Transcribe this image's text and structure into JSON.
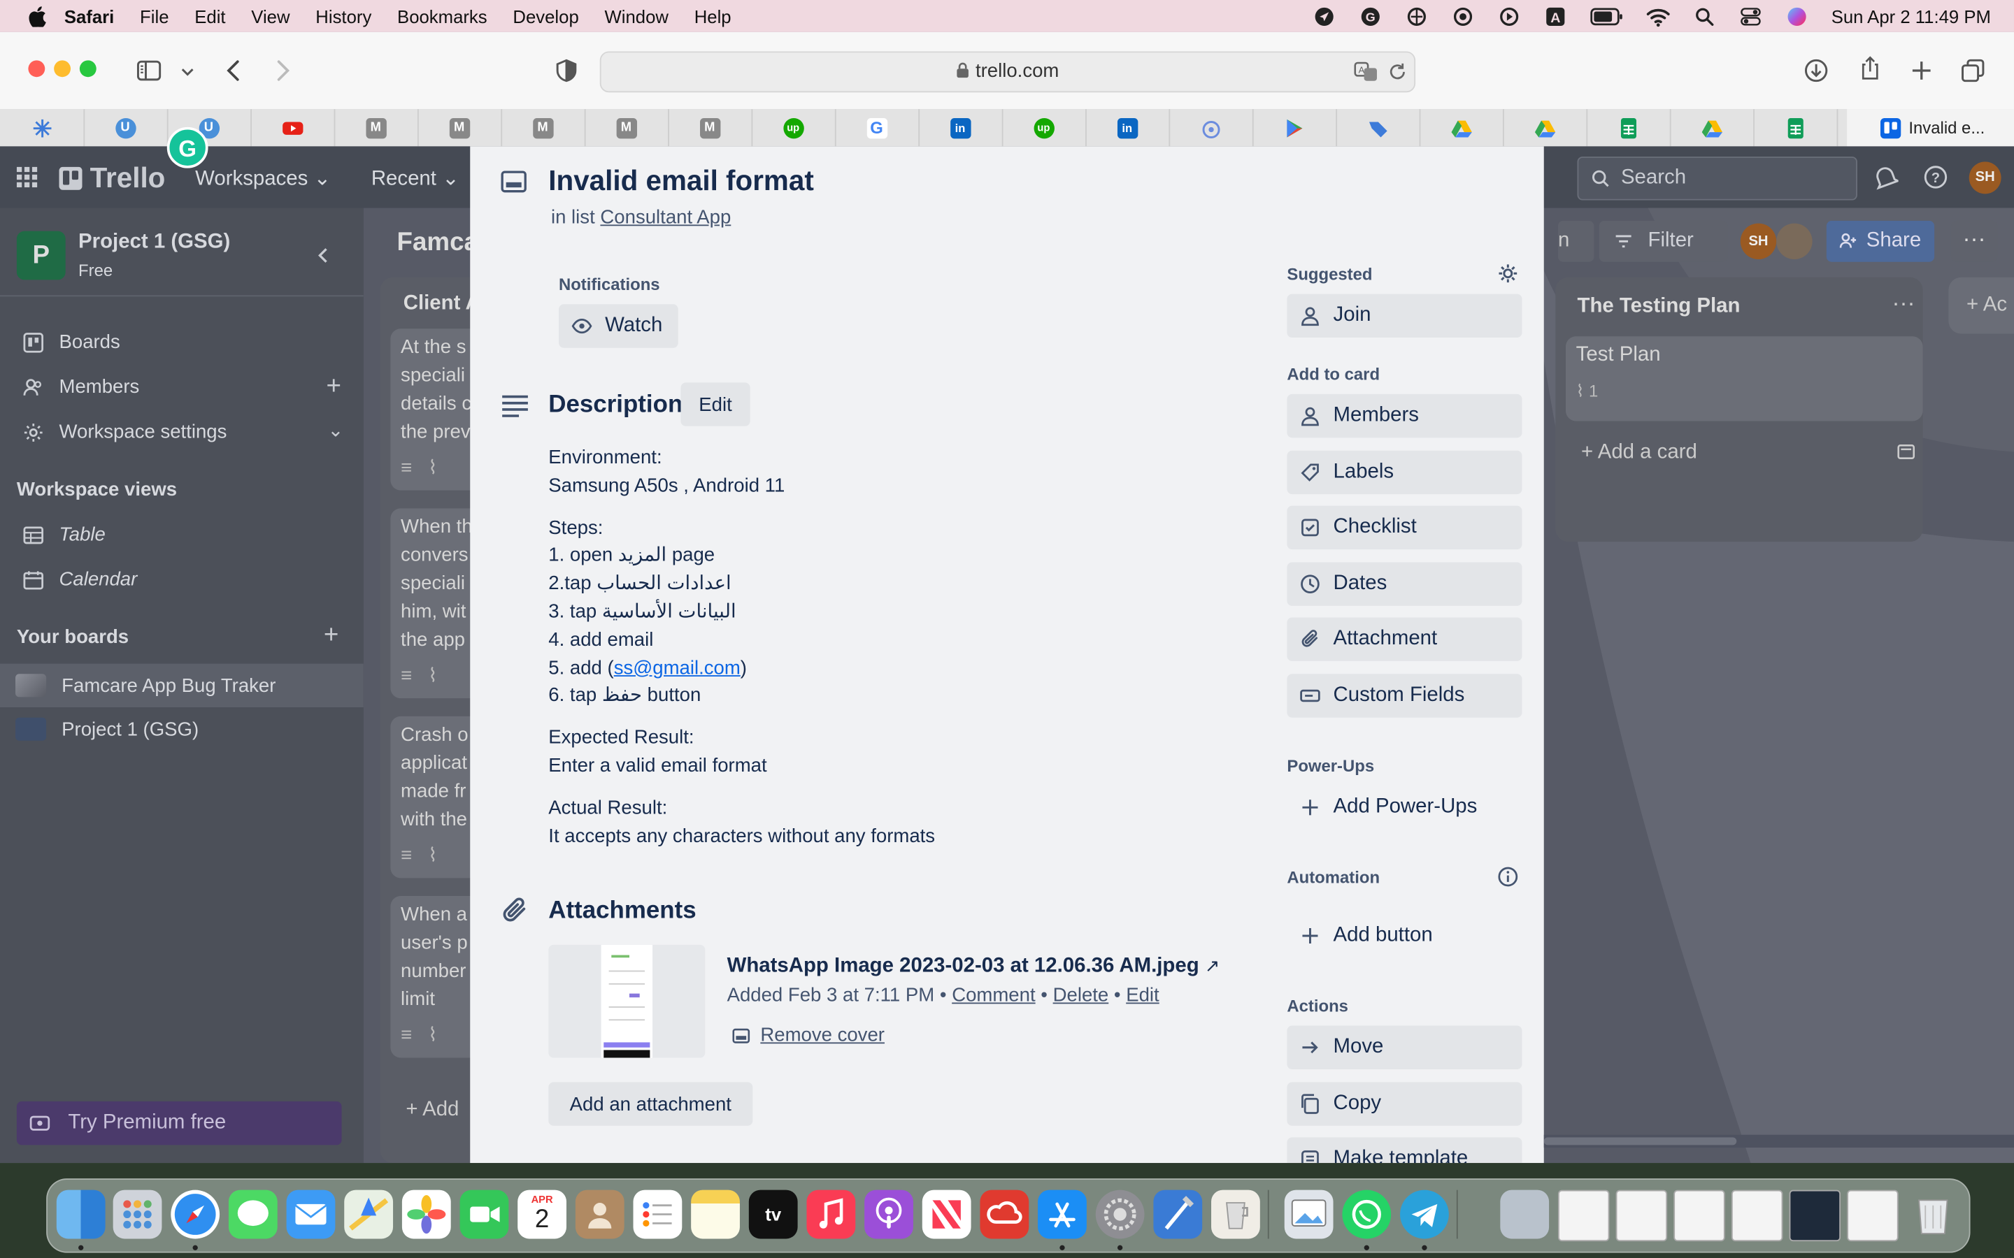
{
  "menubar": {
    "items": [
      "Safari",
      "File",
      "Edit",
      "View",
      "History",
      "Bookmarks",
      "Develop",
      "Window",
      "Help"
    ],
    "clock": "Sun Apr 2  11:49 PM"
  },
  "browser": {
    "url": "trello.com",
    "last_tab_label": "Invalid e..."
  },
  "trello": {
    "logo": "Trello",
    "nav": [
      "Workspaces",
      "Recent"
    ],
    "search_placeholder": "Search",
    "user_initials": "SH",
    "workspace": {
      "letter": "P",
      "name": "Project 1 (GSG)",
      "plan": "Free"
    },
    "sidebar": {
      "items": [
        "Boards",
        "Members",
        "Workspace settings"
      ],
      "views_heading": "Workspace views",
      "views": [
        "Table",
        "Calendar"
      ],
      "boards_heading": "Your boards",
      "boards": [
        "Famcare App Bug Traker",
        "Project 1 (GSG)"
      ],
      "premium": "Try Premium free"
    },
    "board": {
      "title_partial": "Famca",
      "filter": "Filter",
      "share": "Share",
      "left_list_title": "Client A",
      "left_cards": [
        [
          "At the s",
          "speciali",
          "details c",
          "the prev"
        ],
        [
          "When th",
          "convers",
          "speciali",
          "him, wit",
          "the app"
        ],
        [
          "Crash o",
          "applicat",
          "made fr",
          "with the"
        ],
        [
          "When a",
          "user's p",
          "number",
          "limit"
        ]
      ],
      "add_card_partial": "Add",
      "right_list": {
        "title": "The Testing Plan",
        "card": "Test Plan",
        "attachments": "1",
        "add_card": "Add a card"
      },
      "add_list_partial": "Ac"
    }
  },
  "card": {
    "title": "Invalid email format",
    "in_list_prefix": "in list",
    "list_name": "Consultant App",
    "notifications_label": "Notifications",
    "watch": "Watch",
    "description_heading": "Description",
    "edit": "Edit",
    "description": {
      "env_label": "Environment:",
      "env_value": "Samsung A50s , Android 11",
      "steps_label": "Steps:",
      "steps": [
        "1. open المزيد page",
        "2.tap اعدادات الحساب",
        "3. tap البيانات الأساسية",
        "4. add email"
      ],
      "step5_prefix": "5. add (",
      "step5_email": "ss@gmail.com",
      "step5_suffix": ")",
      "step6": "6. tap حفظ button",
      "expected_label": "Expected Result:",
      "expected_value": "Enter a valid email format",
      "actual_label": "Actual Result:",
      "actual_value": "It accepts any characters without any formats"
    },
    "attachments_heading": "Attachments",
    "attachment": {
      "name": "WhatsApp Image 2023-02-03 at 12.06.36 AM.jpeg",
      "added": "Added Feb 3 at 7:11 PM",
      "actions": [
        "Comment",
        "Delete",
        "Edit"
      ],
      "remove_cover": "Remove cover"
    },
    "add_attachment": "Add an attachment",
    "side": {
      "suggested": "Suggested",
      "join": "Join",
      "add_to_card": "Add to card",
      "add_items": [
        "Members",
        "Labels",
        "Checklist",
        "Dates",
        "Attachment",
        "Custom Fields"
      ],
      "powerups": "Power-Ups",
      "add_powerups": "Add Power-Ups",
      "automation": "Automation",
      "add_button": "Add button",
      "actions": "Actions",
      "action_items": [
        "Move",
        "Copy",
        "Make template"
      ]
    }
  },
  "dock": {
    "calendar_month": "APR",
    "calendar_day": "2",
    "tv_label": "tv"
  }
}
